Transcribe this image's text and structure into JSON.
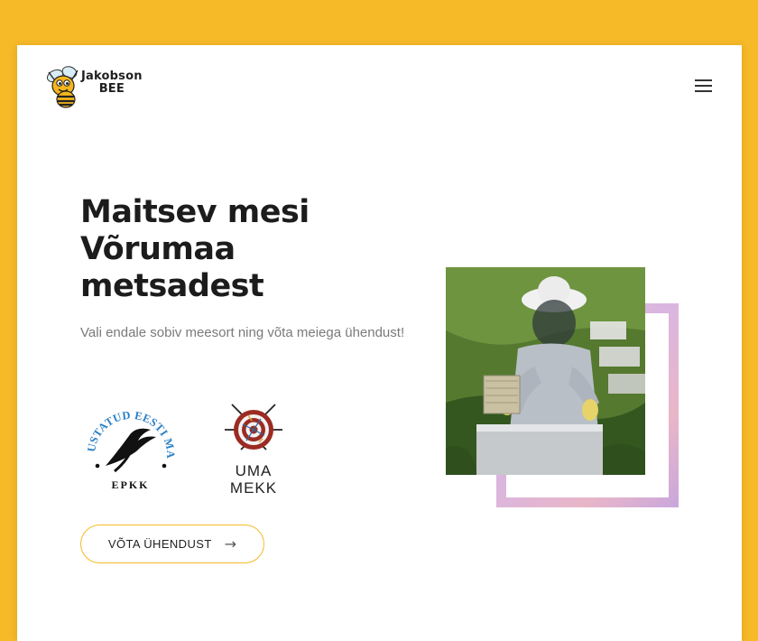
{
  "brand": {
    "name_line1": "Jakobson",
    "name_line2": "BEE"
  },
  "header": {
    "menu_icon": "hamburger-menu-icon"
  },
  "hero": {
    "title_lines": [
      "Maitsev mesi",
      "Võrumaa",
      "metsadest"
    ],
    "subtitle": "Vali endale sobiv meesort ning võta meiega ühendust!",
    "cta_label": "VÕTA ÜHENDUST",
    "cta_icon": "arrow-right-icon"
  },
  "badges": {
    "epkk": {
      "arc_text": "TUNNUSTATUD EESTI MAITSE",
      "bottom_text": "EPKK"
    },
    "uma_mekk": {
      "line1": "UMA",
      "line2": "MEKK"
    }
  },
  "colors": {
    "accent": "#f6b928",
    "frame": "#e0b8d8",
    "title": "#1c1c1c"
  }
}
